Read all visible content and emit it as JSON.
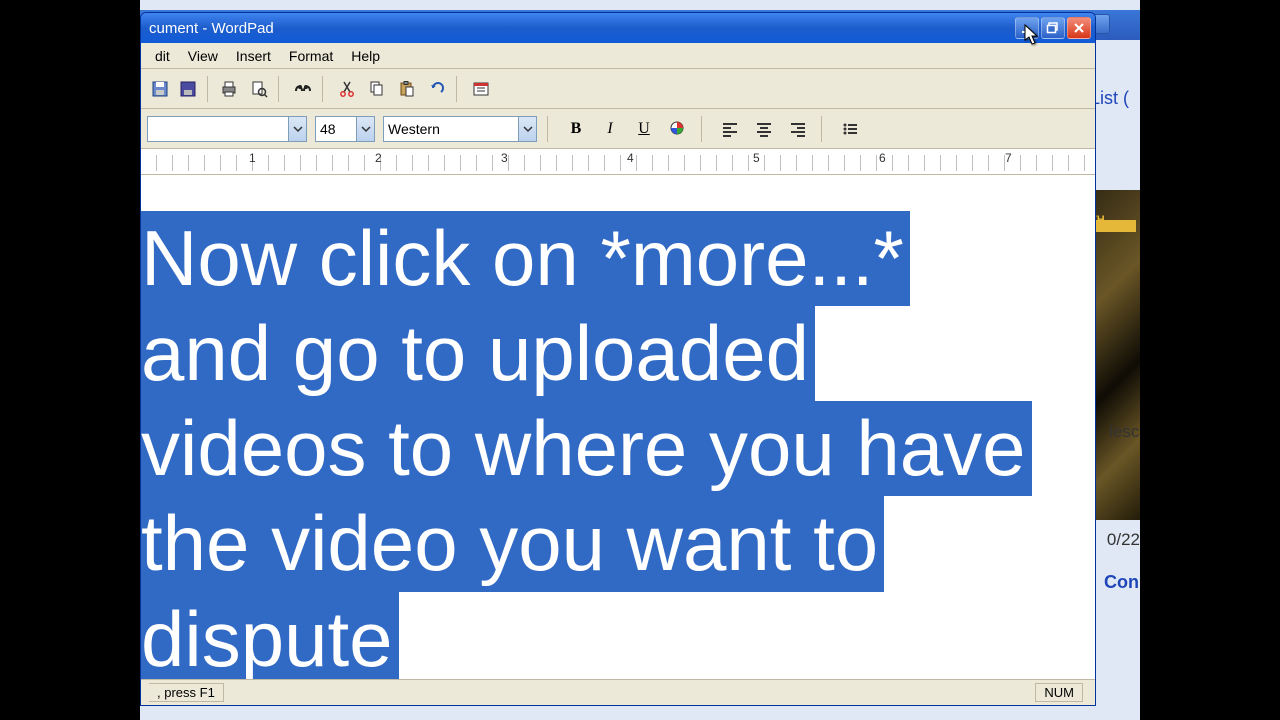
{
  "window": {
    "title_fragment": "cument - WordPad"
  },
  "menus": {
    "edit_fragment": "dit",
    "view": "View",
    "insert": "Insert",
    "format": "Format",
    "help": "Help"
  },
  "format_bar": {
    "font_size": "48",
    "script": "Western"
  },
  "ruler_marks": [
    "1",
    "2",
    "3",
    "4",
    "5",
    "6",
    "7"
  ],
  "document_lines": [
    "Now click on *more...* ",
    "and go to uploaded ",
    "videos to where you have",
    "the video you want to ",
    "dispute"
  ],
  "status": {
    "help_fragment": ", press F1",
    "num": "NUM"
  },
  "behind": {
    "link_text": "List (",
    "time_fragment": "0/22",
    "connect_fragment": "Conn",
    "wide_fragment": "lescr",
    "gold_text": "IN TH"
  },
  "icons": {
    "save": "save-icon",
    "print": "print-icon",
    "preview": "preview-icon",
    "find": "find-icon",
    "cut": "cut-icon",
    "copy": "copy-icon",
    "paste": "paste-icon",
    "undo": "undo-icon",
    "date": "date-icon",
    "bold": "bold-icon",
    "italic": "italic-icon",
    "underline": "underline-icon",
    "color": "color-icon",
    "left": "align-left-icon",
    "center": "align-center-icon",
    "right": "align-right-icon",
    "bullets": "bullets-icon",
    "min": "minimize-icon",
    "max": "restore-icon",
    "close": "close-icon",
    "chevron": "chevron-down-icon"
  }
}
